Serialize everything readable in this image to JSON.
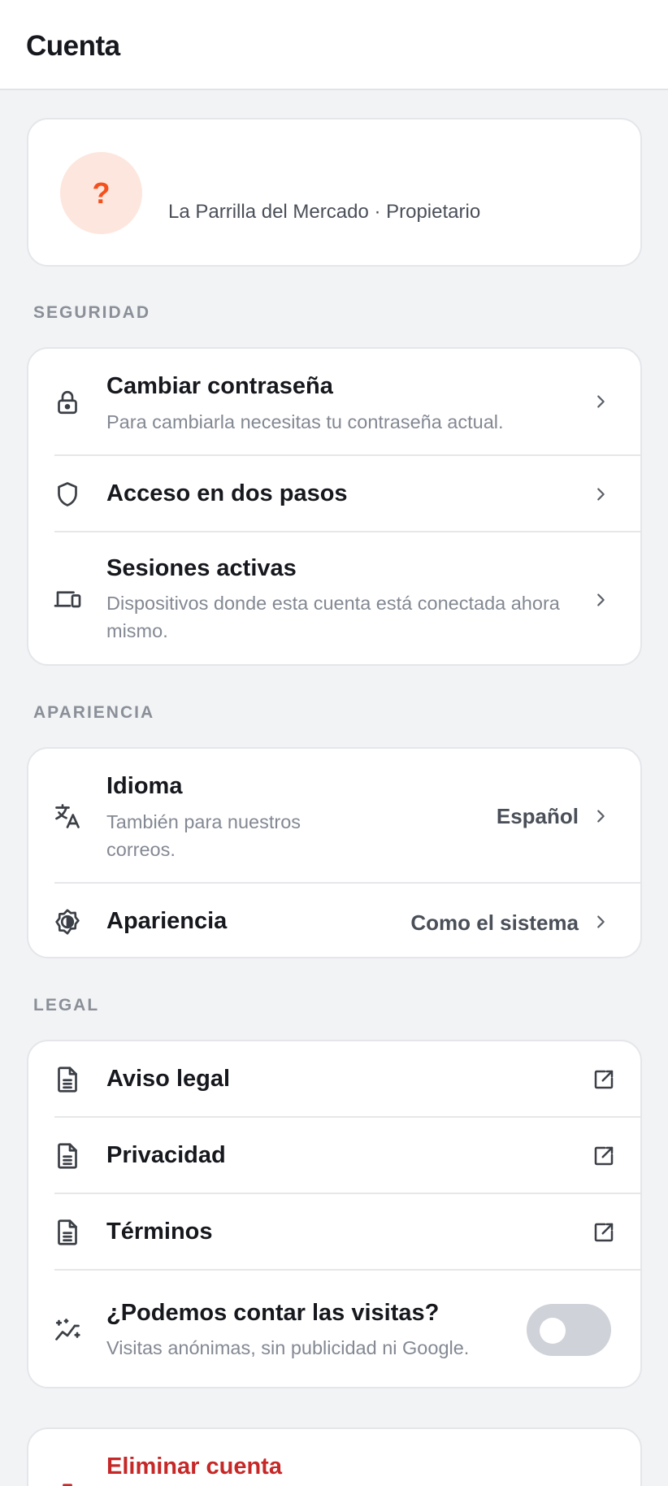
{
  "header": {
    "title": "Cuenta"
  },
  "profile": {
    "avatar_glyph": "?",
    "subtitle": "La Parrilla del Mercado · Propietario"
  },
  "sections": {
    "security": {
      "label": "SEGURIDAD",
      "items": [
        {
          "title": "Cambiar contraseña",
          "description": "Para cambiarla necesitas tu contraseña actual.",
          "icon": "lock-icon"
        },
        {
          "title": "Acceso en dos pasos",
          "icon": "shield-icon"
        },
        {
          "title": "Sesiones activas",
          "description": "Dispositivos donde esta cuenta está conectada ahora mismo.",
          "icon": "devices-icon"
        }
      ]
    },
    "appearance": {
      "label": "APARIENCIA",
      "items": [
        {
          "title": "Idioma",
          "description": "También para nuestros correos.",
          "value": "Español",
          "icon": "translate-icon"
        },
        {
          "title": "Apariencia",
          "value": "Como el sistema",
          "icon": "brightness-icon"
        }
      ]
    },
    "legal": {
      "label": "LEGAL",
      "items": [
        {
          "title": "Aviso legal",
          "icon": "document-icon"
        },
        {
          "title": "Privacidad",
          "icon": "document-icon"
        },
        {
          "title": "Términos",
          "icon": "document-icon"
        },
        {
          "title": "¿Podemos contar las visitas?",
          "description": "Visitas anónimas, sin publicidad ni Google.",
          "icon": "analytics-icon",
          "toggle_on": false
        }
      ]
    }
  },
  "danger": {
    "title": "Eliminar cuenta",
    "icon": "trash-icon"
  },
  "colors": {
    "accent": "#f4511e",
    "danger": "#c62828",
    "background": "#f2f3f5"
  }
}
